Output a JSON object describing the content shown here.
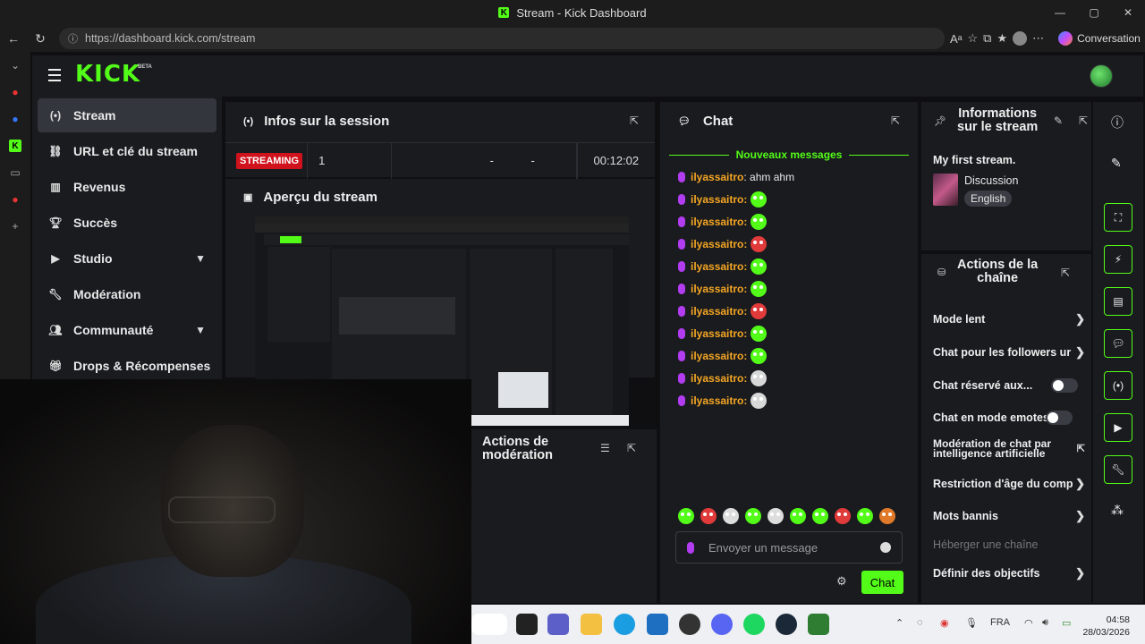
{
  "window": {
    "title": "Stream - Kick Dashboard"
  },
  "browser": {
    "url": "https://dashboard.kick.com/stream",
    "copilot_label": "Conversation"
  },
  "header": {
    "logo": "KICK",
    "beta": "BETA"
  },
  "nav": {
    "items": [
      {
        "label": "Stream",
        "icon": "broadcast-icon"
      },
      {
        "label": "URL et clé du stream",
        "icon": "link-icon"
      },
      {
        "label": "Revenus",
        "icon": "chart-icon"
      },
      {
        "label": "Succès",
        "icon": "trophy-icon"
      },
      {
        "label": "Studio",
        "icon": "video-icon"
      },
      {
        "label": "Modération",
        "icon": "wrench-icon"
      },
      {
        "label": "Communauté",
        "icon": "users-icon"
      },
      {
        "label": "Drops & Récompenses",
        "icon": "gift-icon"
      }
    ]
  },
  "session": {
    "title": "Infos sur la session",
    "status": "STREAMING",
    "viewers": "1",
    "followers": "-",
    "subs": "-",
    "duration": "00:12:02"
  },
  "preview": {
    "title": "Aperçu du stream"
  },
  "moderation": {
    "title_line1": "Actions de",
    "title_line2": "modération"
  },
  "chat": {
    "title": "Chat",
    "new_messages": "Nouveaux messages",
    "first_message": {
      "user": "ilyassaitro",
      "text": ": ahm ahm"
    },
    "emote_messages": [
      "ilyassaitro",
      "ilyassaitro",
      "ilyassaitro",
      "ilyassaitro",
      "ilyassaitro",
      "ilyassaitro",
      "ilyassaitro",
      "ilyassaitro",
      "ilyassaitro",
      "ilyassaitro"
    ],
    "colon": ":",
    "input_placeholder": "Envoyer un message",
    "send_label": "Chat"
  },
  "stream_info": {
    "title_line1": "Informations",
    "title_line2": "sur le stream",
    "stream_title": "My first stream.",
    "category": "Discussion",
    "language": "English"
  },
  "channel_actions": {
    "title_line1": "Actions de la",
    "title_line2": "chaîne",
    "slow_mode": "Mode lent",
    "followers_chat": "Chat pour les followers ur",
    "reserved_chat": "Chat réservé aux...",
    "emotes_chat": "Chat en mode emotes...",
    "ai_moderation_line1": "Modération de chat par",
    "ai_moderation_line2": "intelligence artificielle",
    "age_restriction": "Restriction d'âge du comp",
    "banned_words": "Mots bannis",
    "host_channel": "Héberger une chaîne",
    "set_goals": "Définir des objectifs"
  },
  "taskbar": {
    "lang": "FRA",
    "time": "04:58",
    "date": "28/03/2026"
  },
  "colors": {
    "brand": "#53fc18",
    "live": "#d0121c",
    "username": "#f5a623",
    "mic": "#b23cf0"
  }
}
